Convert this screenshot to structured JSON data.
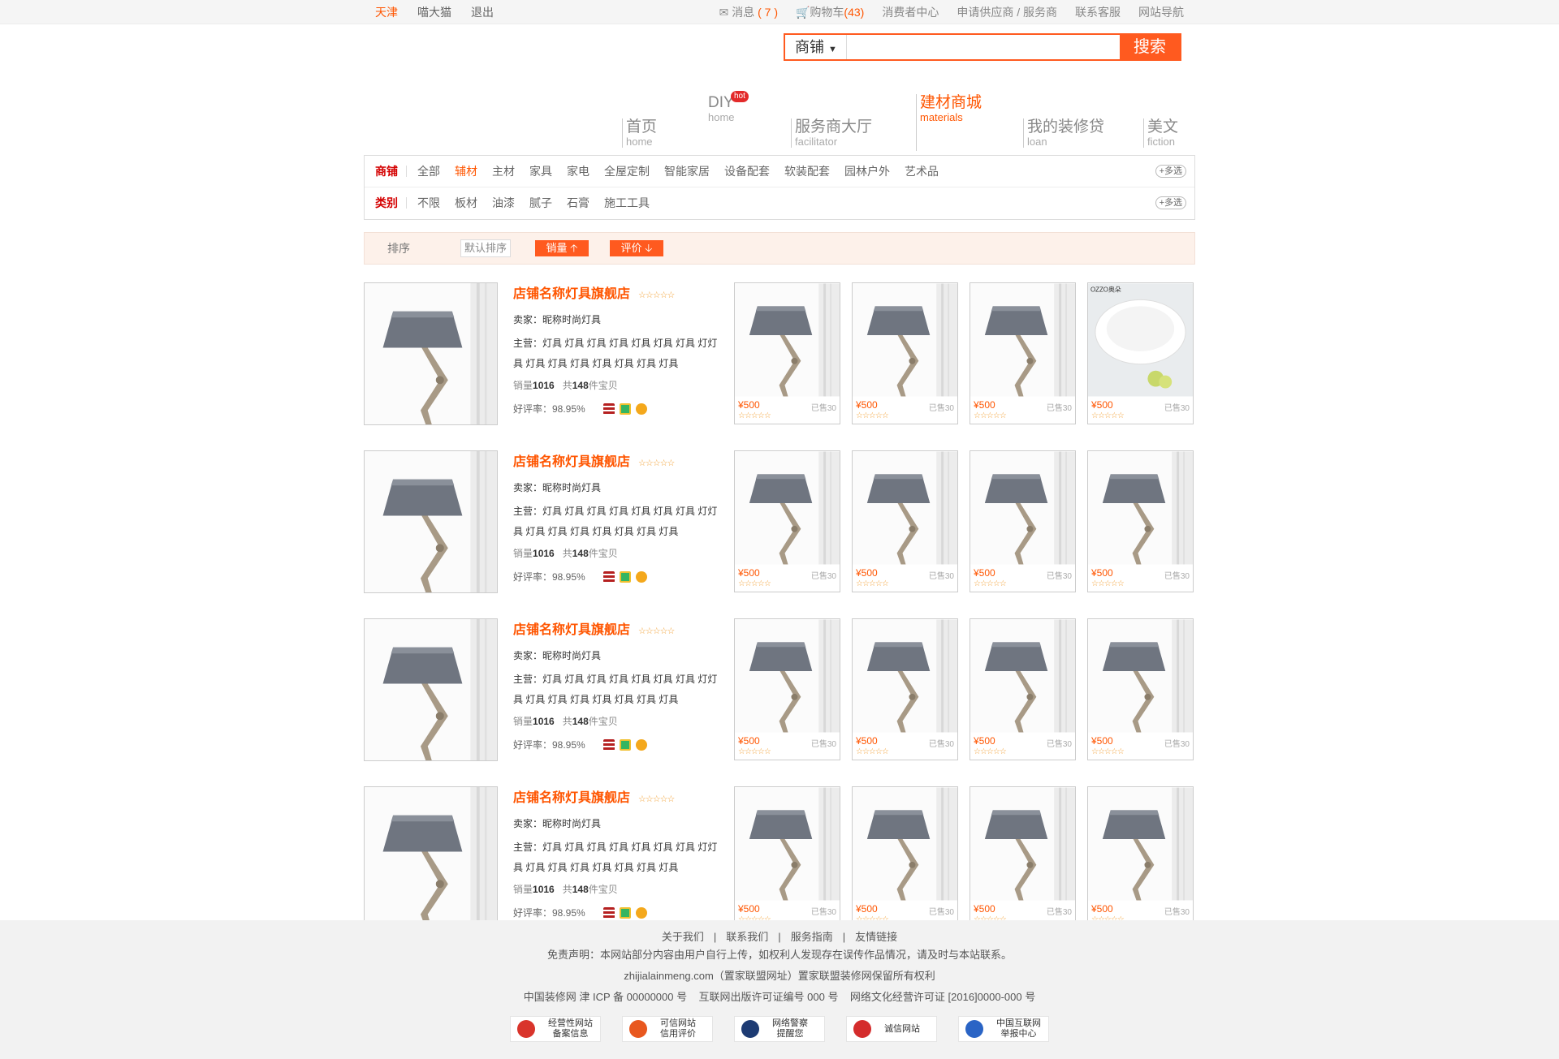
{
  "topbar": {
    "left": [
      "天津",
      "喵大猫",
      "退出"
    ],
    "message_label": "消息",
    "message_count": "( 7 )",
    "cart_label": "购物车",
    "cart_count": "(43)",
    "consumer_center": "消费者中心",
    "apply_supplier": "申请供应商 / 服务商",
    "contact_service": "联系客服",
    "site_nav": "网站导航"
  },
  "search": {
    "scope": "商铺",
    "placeholder": "",
    "button": "搜索"
  },
  "nav": {
    "home": {
      "cn": "首页",
      "en": "home"
    },
    "diy": {
      "cn": "DIY",
      "en": "home",
      "badge": "hot"
    },
    "service": {
      "cn": "服务商大厅",
      "en": "facilitator"
    },
    "materials": {
      "cn": "建材商城",
      "en": "materials"
    },
    "loan": {
      "cn": "我的装修贷",
      "en": "loan"
    },
    "fiction": {
      "cn": "美文",
      "en": "fiction"
    }
  },
  "filters": {
    "shop_label": "商铺",
    "shop_items": [
      "全部",
      "辅材",
      "主材",
      "家具",
      "家电",
      "全屋定制",
      "智能家居",
      "设备配套",
      "软装配套",
      "园林户外",
      "艺术品"
    ],
    "shop_active": "辅材",
    "category_label": "类别",
    "category_items": [
      "不限",
      "板材",
      "油漆",
      "腻子",
      "石膏",
      "施工工具"
    ],
    "more": "+多选"
  },
  "sort": {
    "label": "排序",
    "default": "默认排序",
    "sales": "销量 🡡",
    "rating": "评价 🡣"
  },
  "shops": [
    {
      "name": "店铺名称灯具旗舰店",
      "stars": "☆☆☆☆☆",
      "seller": "卖家：昵称时尚灯具",
      "business": "主营：灯具 灯具 灯具 灯具 灯具 灯具 灯具 灯灯具 灯具 灯具 灯具 灯具 灯具 灯具 灯具",
      "sales_label": "销量",
      "sales": "1016",
      "total_label": "共",
      "total": "148",
      "total_unit": "件宝贝",
      "rate": "好评率：98.95%"
    },
    {
      "name": "店铺名称灯具旗舰店",
      "stars": "☆☆☆☆☆",
      "seller": "卖家：昵称时尚灯具",
      "business": "主营：灯具 灯具 灯具 灯具 灯具 灯具 灯具 灯灯具 灯具 灯具 灯具 灯具 灯具 灯具 灯具",
      "sales_label": "销量",
      "sales": "1016",
      "total_label": "共",
      "total": "148",
      "total_unit": "件宝贝",
      "rate": "好评率：98.95%"
    },
    {
      "name": "店铺名称灯具旗舰店",
      "stars": "☆☆☆☆☆",
      "seller": "卖家：昵称时尚灯具",
      "business": "主营：灯具 灯具 灯具 灯具 灯具 灯具 灯具 灯灯具 灯具 灯具 灯具 灯具 灯具 灯具 灯具",
      "sales_label": "销量",
      "sales": "1016",
      "total_label": "共",
      "total": "148",
      "total_unit": "件宝贝",
      "rate": "好评率：98.95%"
    },
    {
      "name": "店铺名称灯具旗舰店",
      "stars": "☆☆☆☆☆",
      "seller": "卖家：昵称时尚灯具",
      "business": "主营：灯具 灯具 灯具 灯具 灯具 灯具 灯具 灯灯具 灯具 灯具 灯具 灯具 灯具 灯具 灯具",
      "sales_label": "销量",
      "sales": "1016",
      "total_label": "共",
      "total": "148",
      "total_unit": "件宝贝",
      "rate": "好评率：98.95%"
    }
  ],
  "product": {
    "price": "¥500",
    "sold": "已售30",
    "stars": "☆☆☆☆☆"
  },
  "brand_product_text": "OZZO奥朵",
  "footer": {
    "links": [
      "关于我们",
      "|",
      "联系我们",
      "|",
      "服务指南",
      "|",
      "友情链接"
    ],
    "disclaimer": "免责声明：本网站部分内容由用户自行上传，如权利人发现存在误传作品情况，请及时与本站联系。",
    "site": "zhijialainmeng.com（置家联盟网址）置家联盟装修网保留所有权利",
    "icp": "中国装修网 津 ICP 备 00000000 号    互联网出版许可证编号 000 号    网络文化经营许可证 [2016]0000-000 号",
    "badges": [
      {
        "l1": "经营性网站",
        "l2": "备案信息",
        "color": "#d9342b"
      },
      {
        "l1": "可信网站",
        "l2": "信用评价",
        "color": "#e8571e"
      },
      {
        "l1": "网络警察",
        "l2": "提醒您",
        "color": "#1d3b73"
      },
      {
        "l1": "诚信网站",
        "l2": "",
        "color": "#d42c2c"
      },
      {
        "l1": "中国互联网",
        "l2": "举报中心",
        "color": "#2a64c5"
      }
    ]
  }
}
